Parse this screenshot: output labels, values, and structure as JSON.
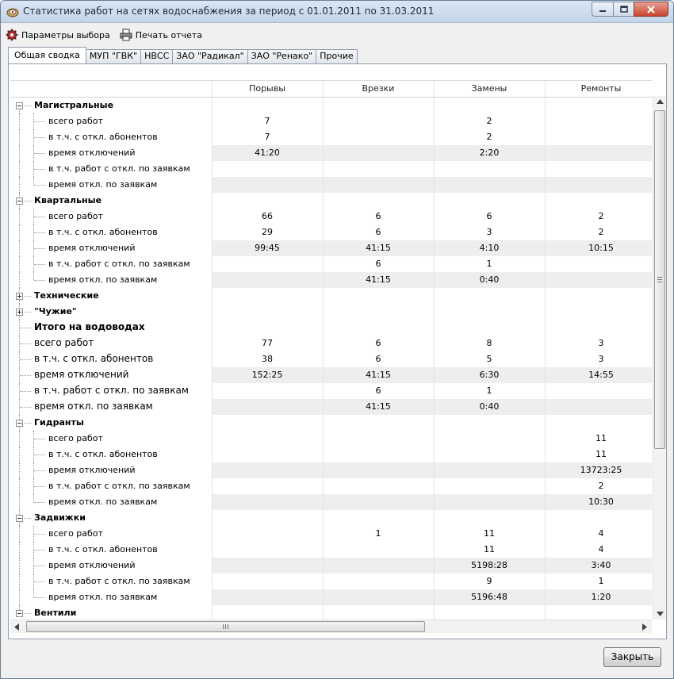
{
  "window": {
    "title": "Статистика работ на сетях водоснабжения за период с 01.01.2011 по 31.03.2011",
    "icon": "app-icon"
  },
  "toolbar": {
    "params_label": "Параметры выбора",
    "print_label": "Печать отчета"
  },
  "tabs": [
    {
      "label": "Общая сводка",
      "active": true
    },
    {
      "label": "МУП \"ГВК\""
    },
    {
      "label": "НВСС"
    },
    {
      "label": "ЗАО \"Радикал\""
    },
    {
      "label": "ЗАО \"Ренако\""
    },
    {
      "label": "Прочие"
    }
  ],
  "columns": [
    "Порывы",
    "Врезки",
    "Замены",
    "Ремонты"
  ],
  "rows": [
    {
      "kind": "group",
      "label": "Магистральные",
      "exp": "minus",
      "vals": [
        "",
        "",
        "",
        ""
      ]
    },
    {
      "kind": "sub",
      "label": "всего работ",
      "vals": [
        "7",
        "",
        "2",
        ""
      ]
    },
    {
      "kind": "sub",
      "label": "в т.ч. с откл. абонентов",
      "vals": [
        "7",
        "",
        "2",
        ""
      ]
    },
    {
      "kind": "sub",
      "label": "время отключений",
      "alt": true,
      "vals": [
        "41:20",
        "",
        "2:20",
        ""
      ]
    },
    {
      "kind": "sub",
      "label": "в т.ч. работ с откл. по заявкам",
      "vals": [
        "",
        "",
        "",
        ""
      ]
    },
    {
      "kind": "sub",
      "label": "время откл. по заявкам",
      "alt": true,
      "vals": [
        "",
        "",
        "",
        ""
      ],
      "last": true
    },
    {
      "kind": "group",
      "label": "Квартальные",
      "exp": "minus",
      "vals": [
        "",
        "",
        "",
        ""
      ]
    },
    {
      "kind": "sub",
      "label": "всего работ",
      "vals": [
        "66",
        "6",
        "6",
        "2"
      ]
    },
    {
      "kind": "sub",
      "label": "в т.ч. с откл. абонентов",
      "vals": [
        "29",
        "6",
        "3",
        "2"
      ]
    },
    {
      "kind": "sub",
      "label": "время отключений",
      "alt": true,
      "vals": [
        "99:45",
        "41:15",
        "4:10",
        "10:15"
      ]
    },
    {
      "kind": "sub",
      "label": "в т.ч. работ с откл. по заявкам",
      "vals": [
        "",
        "6",
        "1",
        ""
      ]
    },
    {
      "kind": "sub",
      "label": "время откл. по заявкам",
      "alt": true,
      "vals": [
        "",
        "41:15",
        "0:40",
        ""
      ],
      "last": true
    },
    {
      "kind": "group",
      "label": "Технические",
      "exp": "plus",
      "vals": [
        "",
        "",
        "",
        ""
      ]
    },
    {
      "kind": "group",
      "label": "\"Чужие\"",
      "exp": "plus",
      "vals": [
        "",
        "",
        "",
        ""
      ]
    },
    {
      "kind": "bigbold",
      "label": "Итого на водоводах",
      "vals": [
        "",
        "",
        "",
        ""
      ]
    },
    {
      "kind": "big",
      "label": "всего работ",
      "vals": [
        "77",
        "6",
        "8",
        "3"
      ]
    },
    {
      "kind": "big",
      "label": "в т.ч. с откл. абонентов",
      "vals": [
        "38",
        "6",
        "5",
        "3"
      ]
    },
    {
      "kind": "big",
      "label": "время отключений",
      "alt": true,
      "vals": [
        "152:25",
        "41:15",
        "6:30",
        "14:55"
      ]
    },
    {
      "kind": "big",
      "label": "в т.ч. работ с откл. по заявкам",
      "vals": [
        "",
        "6",
        "1",
        ""
      ]
    },
    {
      "kind": "big",
      "label": "время откл. по заявкам",
      "alt": true,
      "vals": [
        "",
        "41:15",
        "0:40",
        ""
      ]
    },
    {
      "kind": "group",
      "label": "Гидранты",
      "exp": "minus",
      "vals": [
        "",
        "",
        "",
        ""
      ]
    },
    {
      "kind": "sub",
      "label": "всего работ",
      "vals": [
        "",
        "",
        "",
        "11"
      ]
    },
    {
      "kind": "sub",
      "label": "в т.ч. с откл. абонентов",
      "vals": [
        "",
        "",
        "",
        "11"
      ]
    },
    {
      "kind": "sub",
      "label": "время отключений",
      "alt": true,
      "vals": [
        "",
        "",
        "",
        "13723:25"
      ]
    },
    {
      "kind": "sub",
      "label": "в т.ч. работ с откл. по заявкам",
      "vals": [
        "",
        "",
        "",
        "2"
      ]
    },
    {
      "kind": "sub",
      "label": "время откл. по заявкам",
      "alt": true,
      "vals": [
        "",
        "",
        "",
        "10:30"
      ],
      "last": true
    },
    {
      "kind": "group",
      "label": "Задвижки",
      "exp": "minus",
      "vals": [
        "",
        "",
        "",
        ""
      ]
    },
    {
      "kind": "sub",
      "label": "всего работ",
      "vals": [
        "",
        "1",
        "11",
        "4"
      ]
    },
    {
      "kind": "sub",
      "label": "в т.ч. с откл. абонентов",
      "vals": [
        "",
        "",
        "11",
        "4"
      ]
    },
    {
      "kind": "sub",
      "label": "время отключений",
      "alt": true,
      "vals": [
        "",
        "",
        "5198:28",
        "3:40"
      ]
    },
    {
      "kind": "sub",
      "label": "в т.ч. работ с откл. по заявкам",
      "vals": [
        "",
        "",
        "9",
        "1"
      ]
    },
    {
      "kind": "sub",
      "label": "время откл. по заявкам",
      "alt": true,
      "vals": [
        "",
        "",
        "5196:48",
        "1:20"
      ],
      "last": true
    },
    {
      "kind": "group",
      "label": "Вентили",
      "exp": "minus",
      "vals": [
        "",
        "",
        "",
        ""
      ]
    }
  ],
  "footer": {
    "close_label": "Закрыть"
  }
}
